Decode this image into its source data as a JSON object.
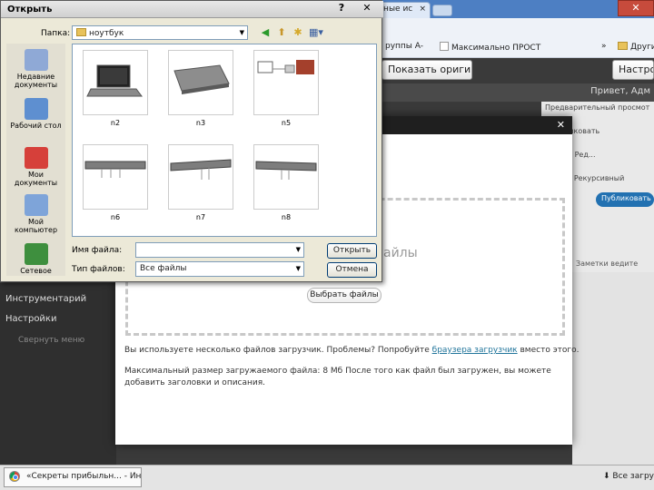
{
  "browser": {
    "tabs": [
      {
        "label": "обные ис",
        "close": "×"
      }
    ],
    "window_controls": {
      "help": "?",
      "close": "✕"
    },
    "bookmarks": [
      {
        "label": "руппы A-",
        "icon": "page-icon"
      },
      {
        "label": "Максимально ПРОСТ",
        "icon": "page-icon"
      },
      {
        "label": "»",
        "icon": ""
      },
      {
        "label": "Други",
        "icon": "folder-icon"
      }
    ],
    "buttons": {
      "show_original": "Показать оригинал",
      "settings": "Настрой"
    },
    "admin_bar": {
      "howdy": "Привет, Адм"
    }
  },
  "background": {
    "right_col": [
      "Предварительный просмот",
      "Опубликовать",
      "Опции: Ред...",
      "Скамп: Рекурсивный"
    ],
    "publish_btn": "Публиковать",
    "left_menu": [
      "Инструментарий",
      "Настройки",
      "Свернуть меню"
    ],
    "mid_text": [
      "Заметки ведите",
      "Я"
    ]
  },
  "uploader": {
    "close": "✕",
    "drop_text": "айлы",
    "select_button": "Выбрать файлы",
    "info_prefix": "Вы используете несколько файлов загрузчик. Проблемы? Попробуйте",
    "info_link": "браузера загрузчик",
    "info_suffix": "вместо этого.",
    "info_size": "Максимальный размер загружаемого файла: 8 Мб После того как файл был загружен, вы можете добавить заголовки и описания."
  },
  "taskbar": {
    "task_label": "«Секреты прибыльн... - Ин",
    "downloads": "Все загрузки"
  },
  "dialog": {
    "title": "Открыть",
    "help": "?",
    "close": "✕",
    "folder_label": "Папка:",
    "folder_value": "ноутбук",
    "toolbar_icons": [
      "back-icon",
      "up-folder-icon",
      "new-folder-icon",
      "view-menu-icon"
    ],
    "places": [
      {
        "label": "Недавние документы",
        "icon": "recent-documents-icon",
        "color": "#8fa9d6"
      },
      {
        "label": "Рабочий стол",
        "icon": "desktop-icon",
        "color": "#5e8fd0"
      },
      {
        "label": "Мои документы",
        "icon": "my-documents-icon",
        "color": "#d6403a"
      },
      {
        "label": "Мой компьютер",
        "icon": "my-computer-icon",
        "color": "#7ea4d9"
      },
      {
        "label": "Сетевое",
        "icon": "network-icon",
        "color": "#3e8f3e"
      }
    ],
    "files": [
      {
        "name": "n2"
      },
      {
        "name": "n3"
      },
      {
        "name": "n5"
      },
      {
        "name": "n6"
      },
      {
        "name": "n7"
      },
      {
        "name": "n8"
      }
    ],
    "filename_label": "Имя файла:",
    "filename_value": "",
    "filetype_label": "Тип файлов:",
    "filetype_value": "Все файлы",
    "open_button": "Открыть",
    "cancel_button": "Отмена"
  }
}
